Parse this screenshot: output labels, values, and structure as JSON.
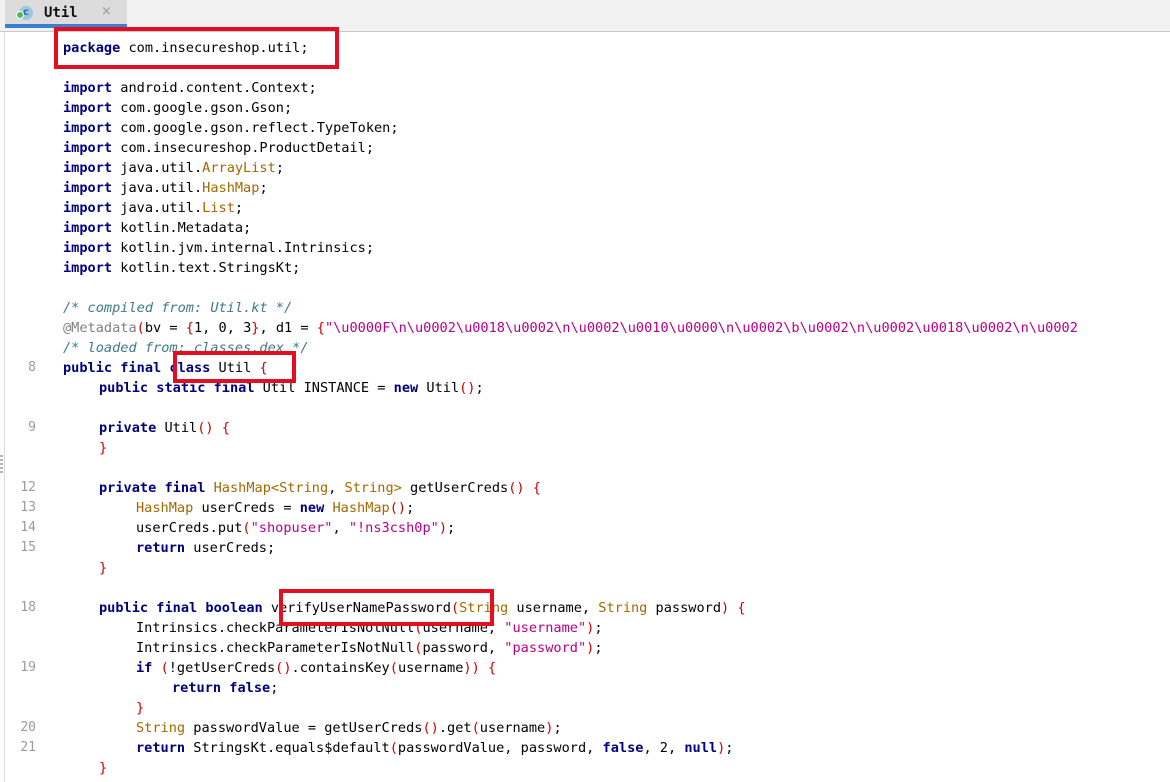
{
  "tab": {
    "label": "Util",
    "icon": "kotlin-class-icon",
    "close": "×"
  },
  "lines": [
    {
      "n": "",
      "i": 0,
      "t": [
        [
          "kw",
          "package"
        ],
        [
          "p",
          " com.insecureshop.util;"
        ]
      ]
    },
    {
      "n": "",
      "i": 0,
      "t": []
    },
    {
      "n": "",
      "i": 0,
      "t": [
        [
          "kw",
          "import"
        ],
        [
          "p",
          " android.content.Context;"
        ]
      ]
    },
    {
      "n": "",
      "i": 0,
      "t": [
        [
          "kw",
          "import"
        ],
        [
          "p",
          " com.google.gson.Gson;"
        ]
      ]
    },
    {
      "n": "",
      "i": 0,
      "t": [
        [
          "kw",
          "import"
        ],
        [
          "p",
          " com.google.gson.reflect.TypeToken;"
        ]
      ]
    },
    {
      "n": "",
      "i": 0,
      "t": [
        [
          "kw",
          "import"
        ],
        [
          "p",
          " com.insecureshop.ProductDetail;"
        ]
      ]
    },
    {
      "n": "",
      "i": 0,
      "t": [
        [
          "kw",
          "import"
        ],
        [
          "p",
          " java.util."
        ],
        [
          "typ",
          "ArrayList"
        ],
        [
          "p",
          ";"
        ]
      ]
    },
    {
      "n": "",
      "i": 0,
      "t": [
        [
          "kw",
          "import"
        ],
        [
          "p",
          " java.util."
        ],
        [
          "typ",
          "HashMap"
        ],
        [
          "p",
          ";"
        ]
      ]
    },
    {
      "n": "",
      "i": 0,
      "t": [
        [
          "kw",
          "import"
        ],
        [
          "p",
          " java.util."
        ],
        [
          "typ",
          "List"
        ],
        [
          "p",
          ";"
        ]
      ]
    },
    {
      "n": "",
      "i": 0,
      "t": [
        [
          "kw",
          "import"
        ],
        [
          "p",
          " kotlin.Metadata;"
        ]
      ]
    },
    {
      "n": "",
      "i": 0,
      "t": [
        [
          "kw",
          "import"
        ],
        [
          "p",
          " kotlin.jvm.internal.Intrinsics;"
        ]
      ]
    },
    {
      "n": "",
      "i": 0,
      "t": [
        [
          "kw",
          "import"
        ],
        [
          "p",
          " kotlin.text.StringsKt;"
        ]
      ]
    },
    {
      "n": "",
      "i": 0,
      "t": []
    },
    {
      "n": "",
      "i": 0,
      "t": [
        [
          "cmt",
          "/* compiled from: Util.kt */"
        ]
      ]
    },
    {
      "n": "",
      "i": 0,
      "t": [
        [
          "ann",
          "@Metadata"
        ],
        [
          "pr",
          "("
        ],
        [
          "p",
          "bv = "
        ],
        [
          "pr",
          "{"
        ],
        [
          "p",
          "1, 0, 3"
        ],
        [
          "pr",
          "}"
        ],
        [
          "p",
          ", d1 = "
        ],
        [
          "pr",
          "{"
        ],
        [
          "str",
          "\"\\u0000F\\n\\u0002\\u0018\\u0002\\n\\u0002\\u0010\\u0000\\n\\u0002\\b\\u0002\\n\\u0002\\u0018\\u0002\\n\\u0002"
        ]
      ]
    },
    {
      "n": "",
      "i": 0,
      "t": [
        [
          "cmt",
          "/* loaded from: classes.dex */"
        ]
      ]
    },
    {
      "n": "8",
      "i": 0,
      "t": [
        [
          "kw",
          "public final class"
        ],
        [
          "p",
          " Util "
        ],
        [
          "pr",
          "{"
        ]
      ]
    },
    {
      "n": "",
      "i": 1,
      "t": [
        [
          "kw",
          "public static final"
        ],
        [
          "p",
          " Util INSTANCE = "
        ],
        [
          "kw",
          "new"
        ],
        [
          "p",
          " Util"
        ],
        [
          "pr",
          "()"
        ],
        [
          "p",
          ";"
        ]
      ]
    },
    {
      "n": "",
      "i": 0,
      "t": []
    },
    {
      "n": "9",
      "i": 1,
      "t": [
        [
          "kw",
          "private"
        ],
        [
          "p",
          " Util"
        ],
        [
          "pr",
          "() {"
        ]
      ]
    },
    {
      "n": "",
      "i": 1,
      "t": [
        [
          "pr",
          "}"
        ]
      ]
    },
    {
      "n": "",
      "i": 0,
      "t": []
    },
    {
      "n": "12",
      "i": 1,
      "t": [
        [
          "kw",
          "private final"
        ],
        [
          "p",
          " "
        ],
        [
          "typ",
          "HashMap<String"
        ],
        [
          "p",
          ", "
        ],
        [
          "typ",
          "String>"
        ],
        [
          "p",
          " getUserCreds"
        ],
        [
          "pr",
          "() {"
        ]
      ]
    },
    {
      "n": "13",
      "i": 2,
      "t": [
        [
          "typ",
          "HashMap"
        ],
        [
          "p",
          " userCreds = "
        ],
        [
          "kw",
          "new"
        ],
        [
          "p",
          " "
        ],
        [
          "typ",
          "HashMap"
        ],
        [
          "pr",
          "()"
        ],
        [
          "p",
          ";"
        ]
      ]
    },
    {
      "n": "14",
      "i": 2,
      "t": [
        [
          "p",
          "userCreds.put"
        ],
        [
          "pr",
          "("
        ],
        [
          "str",
          "\"shopuser\""
        ],
        [
          "p",
          ", "
        ],
        [
          "str",
          "\"!ns3csh0p\""
        ],
        [
          "pr",
          ")"
        ],
        [
          "p",
          ";"
        ]
      ]
    },
    {
      "n": "15",
      "i": 2,
      "t": [
        [
          "kw",
          "return"
        ],
        [
          "p",
          " userCreds;"
        ]
      ]
    },
    {
      "n": "",
      "i": 1,
      "t": [
        [
          "pr",
          "}"
        ]
      ]
    },
    {
      "n": "",
      "i": 0,
      "t": []
    },
    {
      "n": "18",
      "i": 1,
      "t": [
        [
          "kw",
          "public final boolean"
        ],
        [
          "p",
          " verifyUserNamePassword"
        ],
        [
          "pr",
          "("
        ],
        [
          "typ",
          "String"
        ],
        [
          "p",
          " username, "
        ],
        [
          "typ",
          "String"
        ],
        [
          "p",
          " password"
        ],
        [
          "pr",
          ") {"
        ]
      ]
    },
    {
      "n": "",
      "i": 2,
      "t": [
        [
          "p",
          "Intrinsics.checkParameterIsNotNull"
        ],
        [
          "pr",
          "("
        ],
        [
          "p",
          "username, "
        ],
        [
          "str",
          "\"username\""
        ],
        [
          "pr",
          ")"
        ],
        [
          "p",
          ";"
        ]
      ]
    },
    {
      "n": "",
      "i": 2,
      "t": [
        [
          "p",
          "Intrinsics.checkParameterIsNotNull"
        ],
        [
          "pr",
          "("
        ],
        [
          "p",
          "password, "
        ],
        [
          "str",
          "\"password\""
        ],
        [
          "pr",
          ")"
        ],
        [
          "p",
          ";"
        ]
      ]
    },
    {
      "n": "19",
      "i": 2,
      "t": [
        [
          "kw",
          "if"
        ],
        [
          "p",
          " "
        ],
        [
          "pr",
          "("
        ],
        [
          "p",
          "!getUserCreds"
        ],
        [
          "pr",
          "()"
        ],
        [
          "p",
          ".containsKey"
        ],
        [
          "pr",
          "("
        ],
        [
          "p",
          "username"
        ],
        [
          "pr",
          "))"
        ],
        [
          "p",
          " "
        ],
        [
          "pr",
          "{"
        ]
      ]
    },
    {
      "n": "",
      "i": 3,
      "t": [
        [
          "kw",
          "return false"
        ],
        [
          "p",
          ";"
        ]
      ]
    },
    {
      "n": "",
      "i": 2,
      "t": [
        [
          "pr",
          "}"
        ]
      ]
    },
    {
      "n": "20",
      "i": 2,
      "t": [
        [
          "typ",
          "String"
        ],
        [
          "p",
          " passwordValue = getUserCreds"
        ],
        [
          "pr",
          "()"
        ],
        [
          "p",
          ".get"
        ],
        [
          "pr",
          "("
        ],
        [
          "p",
          "username"
        ],
        [
          "pr",
          ")"
        ],
        [
          "p",
          ";"
        ]
      ]
    },
    {
      "n": "21",
      "i": 2,
      "t": [
        [
          "kw",
          "return"
        ],
        [
          "p",
          " StringsKt.equals$default"
        ],
        [
          "pr",
          "("
        ],
        [
          "p",
          "passwordValue, password, "
        ],
        [
          "kw",
          "false"
        ],
        [
          "p",
          ", 2, "
        ],
        [
          "kw",
          "null"
        ],
        [
          "pr",
          ")"
        ],
        [
          "p",
          ";"
        ]
      ]
    },
    {
      "n": "",
      "i": 1,
      "t": [
        [
          "pr",
          "}"
        ]
      ]
    }
  ]
}
